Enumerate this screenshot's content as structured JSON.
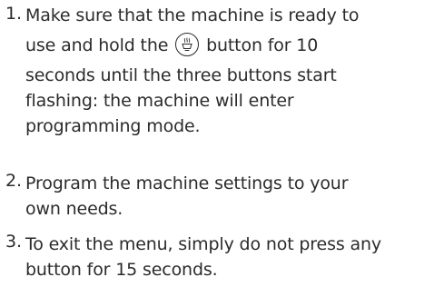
{
  "steps": [
    {
      "number": "1.",
      "text_before_icon": "Make sure that the machine is ready to use and hold the",
      "icon": "hot-water-icon",
      "text_after_icon": "button for 10 seconds until the three buttons start flashing: the machine will enter programming mode.",
      "lines": [
        "Make sure that the machine is ready to",
        "use and hold the",
        "button for 10",
        "seconds until the three buttons start",
        "flashing: the machine will enter",
        "programming mode."
      ]
    },
    {
      "number": "2.",
      "lines": [
        "Program the machine settings to your",
        "own needs."
      ]
    },
    {
      "number": "3.",
      "lines": [
        "To exit the menu, simply do not press any",
        "button for 15 seconds."
      ]
    }
  ],
  "colors": {
    "text": "#2b2b2b",
    "background": "#ffffff"
  }
}
